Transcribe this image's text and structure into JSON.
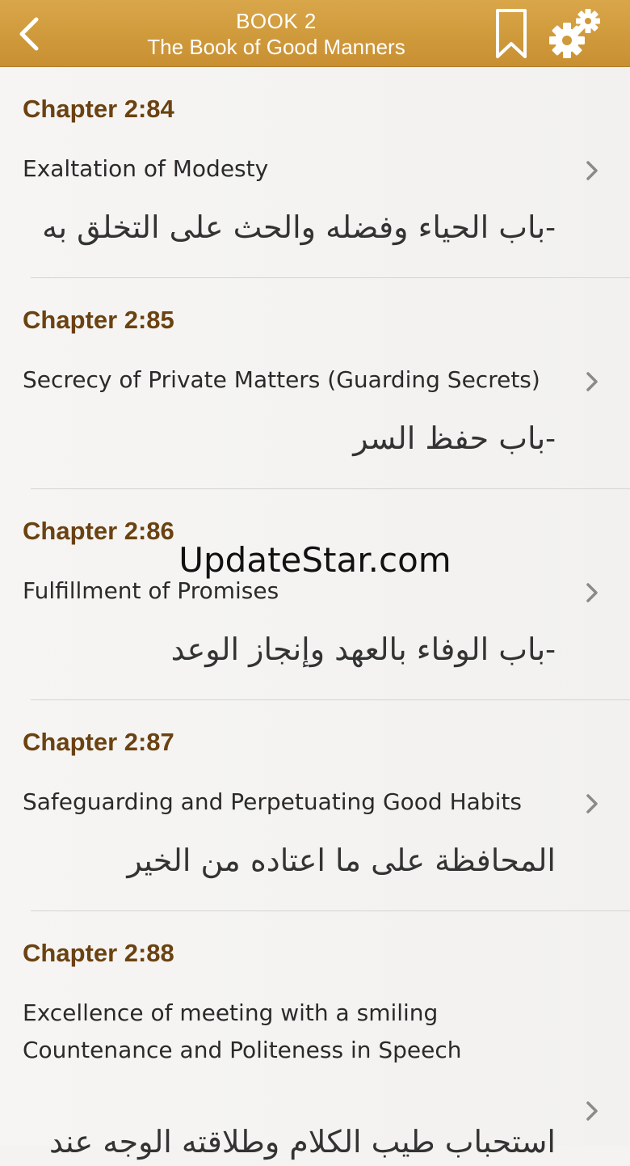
{
  "nav": {
    "book": "BOOK 2",
    "subtitle": "The Book of Good Manners",
    "colors": {
      "bar": "#cf9a3b",
      "text": "#ffffff"
    },
    "icons": [
      "chevron-left-icon",
      "bookmark-icon",
      "gears-icon"
    ]
  },
  "chapters": [
    {
      "number": "Chapter 2:84",
      "english": "Exaltation of Modesty",
      "arabic": "-باب الحياء وفضله والحث على التخلق به"
    },
    {
      "number": "Chapter 2:85",
      "english": "Secrecy of Private Matters (Guarding Secrets)",
      "arabic": "-باب حفظ السر"
    },
    {
      "number": "Chapter 2:86",
      "english": "Fulfillment of Promises",
      "arabic": "-باب الوفاء بالعهد وإنجاز الوعد"
    },
    {
      "number": "Chapter 2:87",
      "english": "Safeguarding and Perpetuating Good Habits",
      "arabic": "المحافظة على ما اعتاده من الخير"
    },
    {
      "number": "Chapter 2:88",
      "english": "Excellence of meeting with a smiling Countenance and Politeness in Speech",
      "arabic": "استحباب طيب الكلام وطلاقته الوجه عند"
    }
  ],
  "chapter_color": "#6b4212",
  "row_icon": "chevron-right-icon",
  "watermark": "UpdateStar.com"
}
